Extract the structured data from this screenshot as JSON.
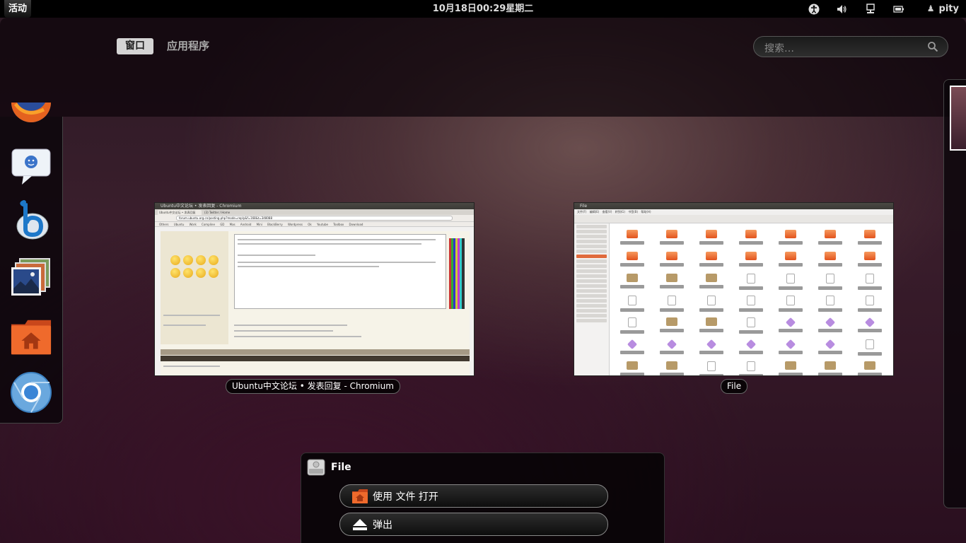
{
  "topbar": {
    "activities": "活动",
    "clock": "10月18日00:29星期二",
    "user": "pity",
    "tray_icons": [
      "accessibility-icon",
      "volume-icon",
      "network-icon",
      "battery-icon"
    ]
  },
  "overview": {
    "tabs": [
      "窗口",
      "应用程序"
    ],
    "active_tab": "窗口",
    "search_placeholder": "搜索…"
  },
  "dash": {
    "items": [
      "firefox-icon",
      "empathy-icon",
      "banshee-icon",
      "shotwell-icon",
      "home-folder-icon",
      "chromium-icon"
    ]
  },
  "windows": [
    {
      "caption": "Ubuntu中文论坛 • 发表回复 - Chromium",
      "titlebar": "Ubuntu中文论坛 • 发表回复 - Chromium",
      "tabs": [
        "Ubuntu中文论坛 • 发表回复",
        "(3) Twitter / Home"
      ],
      "address": "forum.ubuntu.org.cn/posting.php?mode=reply&f=168&t=348088",
      "bookmarks": "Others Ubuntu Work Compline GD Mas Android Mini BlackBerry Wordpress Ok Youtube Toolbox Download"
    },
    {
      "caption": "File",
      "titlebar": "File",
      "menu": "文件(F) 编辑(E) 查看(V) 转到(G) 书签(B) 帮助(H)"
    }
  ],
  "popup": {
    "title": "File",
    "actions": [
      "使用 文件 打开",
      "弹出"
    ]
  },
  "colors": {
    "accent_orange": "#e2531d",
    "topbar_bg": "#000000",
    "tab_active_bg": "#d4d4d4"
  }
}
